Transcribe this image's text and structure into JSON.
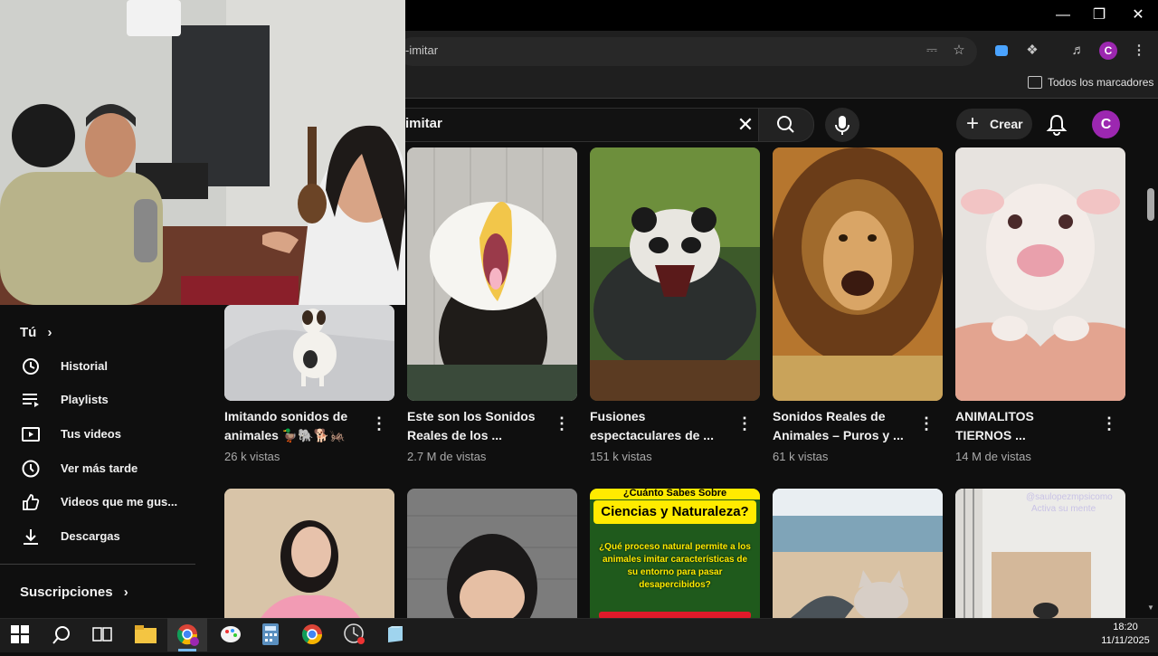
{
  "browser": {
    "omnibox_text": "-imitar",
    "bookmarks_folder": "Todos los marcadores"
  },
  "youtube": {
    "search_value": "imitar",
    "create_label": "Crear",
    "avatar_letter": "C"
  },
  "sidebar": {
    "you_label": "Tú",
    "items": [
      {
        "label": "Historial",
        "icon": "history-icon"
      },
      {
        "label": "Playlists",
        "icon": "playlist-icon"
      },
      {
        "label": "Tus videos",
        "icon": "my-videos-icon"
      },
      {
        "label": "Ver más tarde",
        "icon": "watch-later-icon"
      },
      {
        "label": "Videos que me gus...",
        "icon": "like-icon"
      },
      {
        "label": "Descargas",
        "icon": "download-icon"
      }
    ],
    "subscriptions_label": "Suscripciones"
  },
  "videos": [
    {
      "title1": "Imitando sonidos de",
      "title2": "animales 🦆🐘🐕🦗",
      "views": "26 k vistas",
      "thumb": "dog"
    },
    {
      "title1": "Este son los Sonidos",
      "title2": "Reales de los ...",
      "views": "2.7 M de vistas",
      "thumb": "eagle"
    },
    {
      "title1": "Fusiones",
      "title2": "espectaculares de ...",
      "views": "151 k vistas",
      "thumb": "panda-croc"
    },
    {
      "title1": "Sonidos Reales de",
      "title2": "Animales – Puros y ...",
      "views": "61 k vistas",
      "thumb": "lion"
    },
    {
      "title1": "ANIMALITOS",
      "title2": "TIERNOS ...",
      "views": "14 M de vistas",
      "thumb": "calf"
    }
  ],
  "row2": {
    "quiz_top": "¿Cuánto Sabes Sobre",
    "quiz_title": "Ciencias y Naturaleza?",
    "quiz_question": "¿Qué proceso natural permite a los animales imitar características de su entorno para pasar desapercibidos?",
    "watermark1": "@saulopezmpsicomo",
    "watermark2": "Activa su mente"
  },
  "taskbar": {
    "time": "18:20",
    "date": "11/11/2025"
  },
  "colors": {
    "background": "#0f0f0f",
    "avatar": "#9c27b0",
    "quiz_yellow": "#ffeb00"
  }
}
